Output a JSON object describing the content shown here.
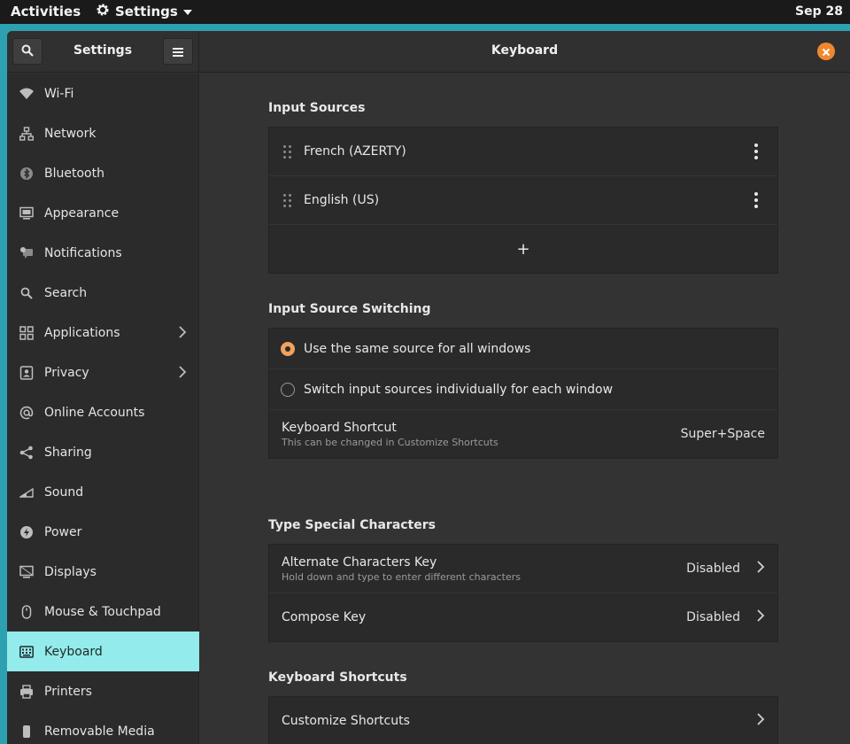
{
  "topbar": {
    "activities": "Activities",
    "app_name": "Settings",
    "date": "Sep 28"
  },
  "window": {
    "sidebar_title": "Settings",
    "page_title": "Keyboard"
  },
  "sidebar": {
    "items": [
      {
        "label": "Wi-Fi",
        "icon": "wifi-icon"
      },
      {
        "label": "Network",
        "icon": "network-icon"
      },
      {
        "label": "Bluetooth",
        "icon": "bluetooth-icon"
      },
      {
        "label": "Appearance",
        "icon": "appearance-icon"
      },
      {
        "label": "Notifications",
        "icon": "notifications-icon"
      },
      {
        "label": "Search",
        "icon": "search-icon"
      },
      {
        "label": "Applications",
        "icon": "applications-icon",
        "has_submenu": true
      },
      {
        "label": "Privacy",
        "icon": "privacy-icon",
        "has_submenu": true
      },
      {
        "label": "Online Accounts",
        "icon": "at-icon"
      },
      {
        "label": "Sharing",
        "icon": "share-icon"
      },
      {
        "label": "Sound",
        "icon": "sound-icon"
      },
      {
        "label": "Power",
        "icon": "power-icon"
      },
      {
        "label": "Displays",
        "icon": "display-icon"
      },
      {
        "label": "Mouse & Touchpad",
        "icon": "mouse-icon"
      },
      {
        "label": "Keyboard",
        "icon": "keyboard-icon",
        "active": true
      },
      {
        "label": "Printers",
        "icon": "printer-icon"
      },
      {
        "label": "Removable Media",
        "icon": "media-icon"
      }
    ]
  },
  "input_sources": {
    "title": "Input Sources",
    "sources": [
      "French (AZERTY)",
      "English (US)"
    ],
    "add_label": "+"
  },
  "switching": {
    "title": "Input Source Switching",
    "option_same": "Use the same source for all windows",
    "option_individual": "Switch input sources individually for each window",
    "selected": "same",
    "shortcut_label": "Keyboard Shortcut",
    "shortcut_sub": "This can be changed in Customize Shortcuts",
    "shortcut_value": "Super+Space"
  },
  "special_chars": {
    "title": "Type Special Characters",
    "alt_label": "Alternate Characters Key",
    "alt_sub": "Hold down and type to enter different characters",
    "alt_value": "Disabled",
    "compose_label": "Compose Key",
    "compose_value": "Disabled"
  },
  "shortcuts": {
    "title": "Keyboard Shortcuts",
    "customize_label": "Customize Shortcuts"
  },
  "colors": {
    "accent": "#f0872e",
    "radio_selected": "#f0a15e",
    "active_sidebar": "#94ebeb",
    "desktop": "#2ea1b0"
  }
}
